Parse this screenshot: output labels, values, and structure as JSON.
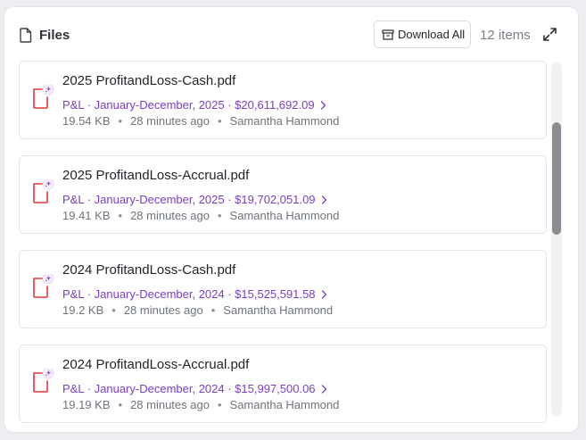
{
  "header": {
    "title": "Files",
    "download_label": "Download All",
    "items_count": "12 items"
  },
  "files": [
    {
      "name": "2025 ProfitandLoss-Cash.pdf",
      "meta": "P&L · January-December, 2025 · $20,611,692.09",
      "size": "19.54 KB",
      "time": "28 minutes ago",
      "author": "Samantha Hammond"
    },
    {
      "name": "2025 ProfitandLoss-Accrual.pdf",
      "meta": "P&L · January-December, 2025 · $19,702,051.09",
      "size": "19.41 KB",
      "time": "28 minutes ago",
      "author": "Samantha Hammond"
    },
    {
      "name": "2024 ProfitandLoss-Cash.pdf",
      "meta": "P&L · January-December, 2024 · $15,525,591.58",
      "size": "19.2 KB",
      "time": "28 minutes ago",
      "author": "Samantha Hammond"
    },
    {
      "name": "2024 ProfitandLoss-Accrual.pdf",
      "meta": "P&L · January-December, 2024 · $15,997,500.06",
      "size": "19.19 KB",
      "time": "28 minutes ago",
      "author": "Samantha Hammond"
    }
  ],
  "icons": {
    "header": "file-icon",
    "download": "archive-icon",
    "expand": "expand-icon",
    "file": "pdf-file-icon",
    "badge": "sparkle-icon",
    "chevron": "chevron-right-icon"
  },
  "colors": {
    "accent": "#7b3fc4",
    "pdf_red": "#e0383e",
    "muted": "#6e747b"
  }
}
